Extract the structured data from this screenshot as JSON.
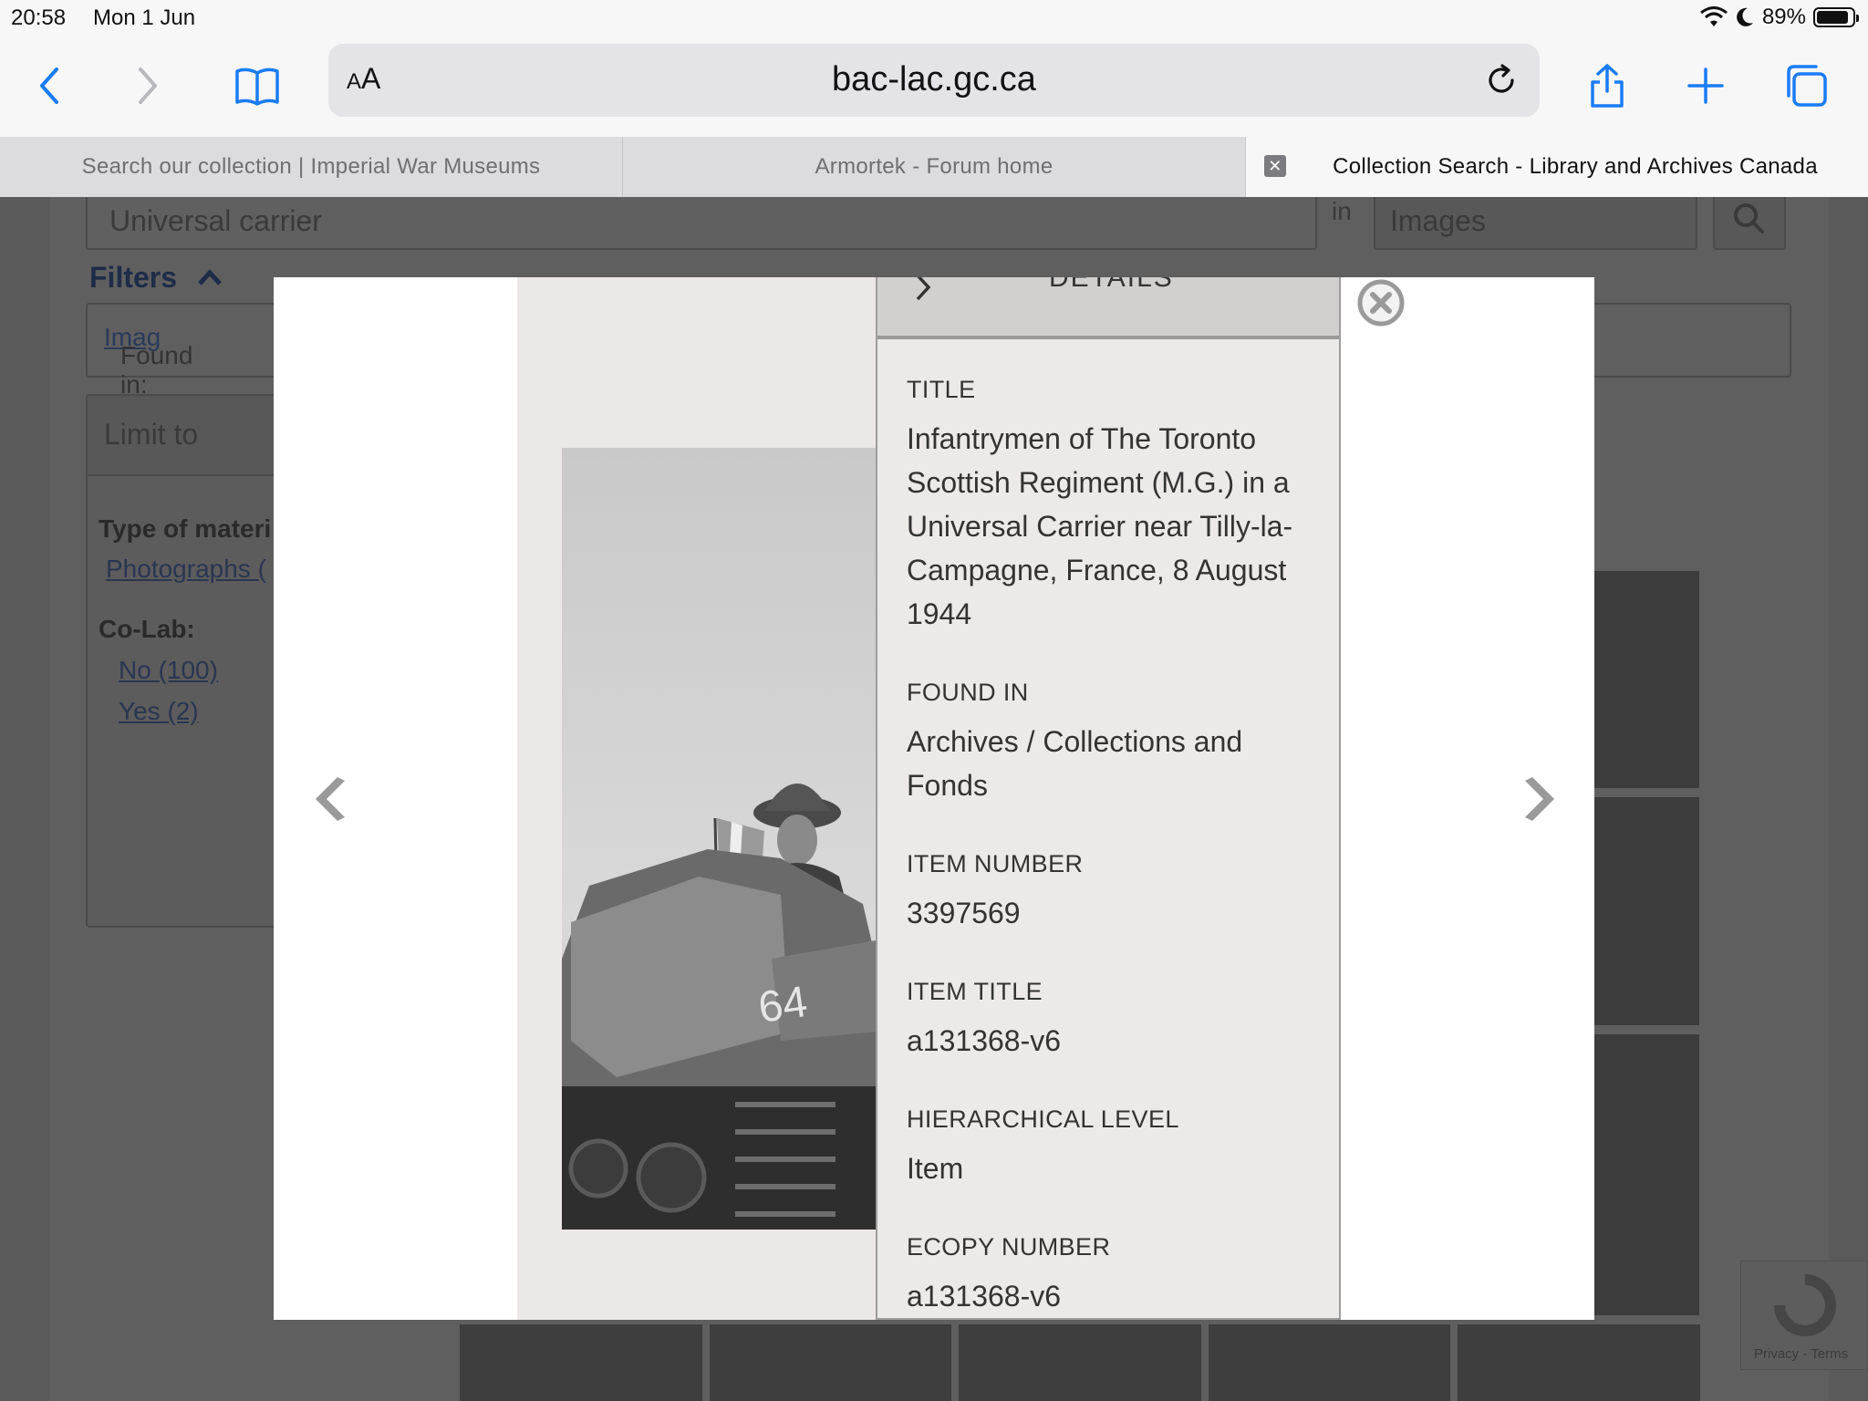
{
  "status_bar": {
    "time": "20:58",
    "date": "Mon 1 Jun",
    "battery": "89%",
    "battery_level": 0.89
  },
  "browser": {
    "url": "bac-lac.gc.ca",
    "text_size_label_small": "A",
    "text_size_label_large": "A",
    "tabs": [
      {
        "label": "Search our collection | Imperial War Museums"
      },
      {
        "label": "Armortek - Forum home"
      },
      {
        "label": "Collection Search - Library and Archives Canada",
        "active": true
      }
    ]
  },
  "page": {
    "search_value": "Universal carrier",
    "in_label": "in",
    "scope_value": "Images",
    "filters_label": "Filters",
    "found_in_prefix": "Found in: ",
    "found_in_link": "Imag",
    "limit_to_label": "Limit to",
    "type_of_material_label": "Type of materi",
    "photographs_link": "Photographs (",
    "colab_label": "Co-Lab:",
    "colab_no": "No (100)",
    "colab_yes": "Yes (2)",
    "recaptcha_text": "Privacy - Terms"
  },
  "modal": {
    "details_header": "DETAILS",
    "fields": [
      {
        "key": "TITLE",
        "value": "Infantrymen of The Toronto Scottish Regiment (M.G.) in a Universal Carrier near Tilly-la-Campagne, France, 8 August 1944"
      },
      {
        "key": "FOUND IN",
        "value": "Archives / Collections and Fonds"
      },
      {
        "key": "ITEM NUMBER",
        "value": "3397569"
      },
      {
        "key": "ITEM TITLE",
        "value": "a131368-v6"
      },
      {
        "key": "HIERARCHICAL LEVEL",
        "value": "Item"
      },
      {
        "key": "ECOPY NUMBER",
        "value": "a131368-v6"
      }
    ]
  }
}
